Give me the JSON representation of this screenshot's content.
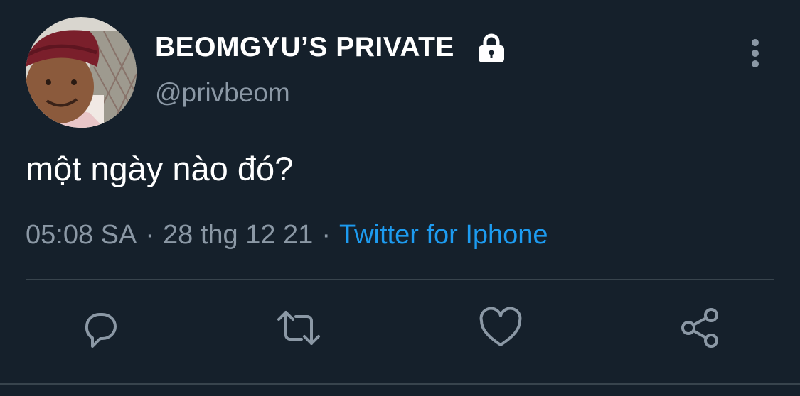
{
  "user": {
    "display_name": "BEOMGYU’S PRIVATE",
    "handle": "@privbeom",
    "avatar_icon": "profile-photo",
    "protected_icon": "lock-icon"
  },
  "tweet": {
    "text": "một ngày nào đó?",
    "time": "05:08 SA",
    "separator": "·",
    "date": "28 thg 12 21",
    "source": "Twitter for Iphone"
  },
  "actions": [
    {
      "name": "reply",
      "icon": "reply-icon"
    },
    {
      "name": "retweet",
      "icon": "retweet-icon"
    },
    {
      "name": "like",
      "icon": "heart-icon"
    },
    {
      "name": "share",
      "icon": "share-icon"
    }
  ],
  "colors": {
    "background": "#15202b",
    "primary_text": "#ffffff",
    "secondary_text": "#8b98a5",
    "link": "#1d9bf0",
    "divider": "#38444d",
    "icon": "#8b98a5"
  }
}
